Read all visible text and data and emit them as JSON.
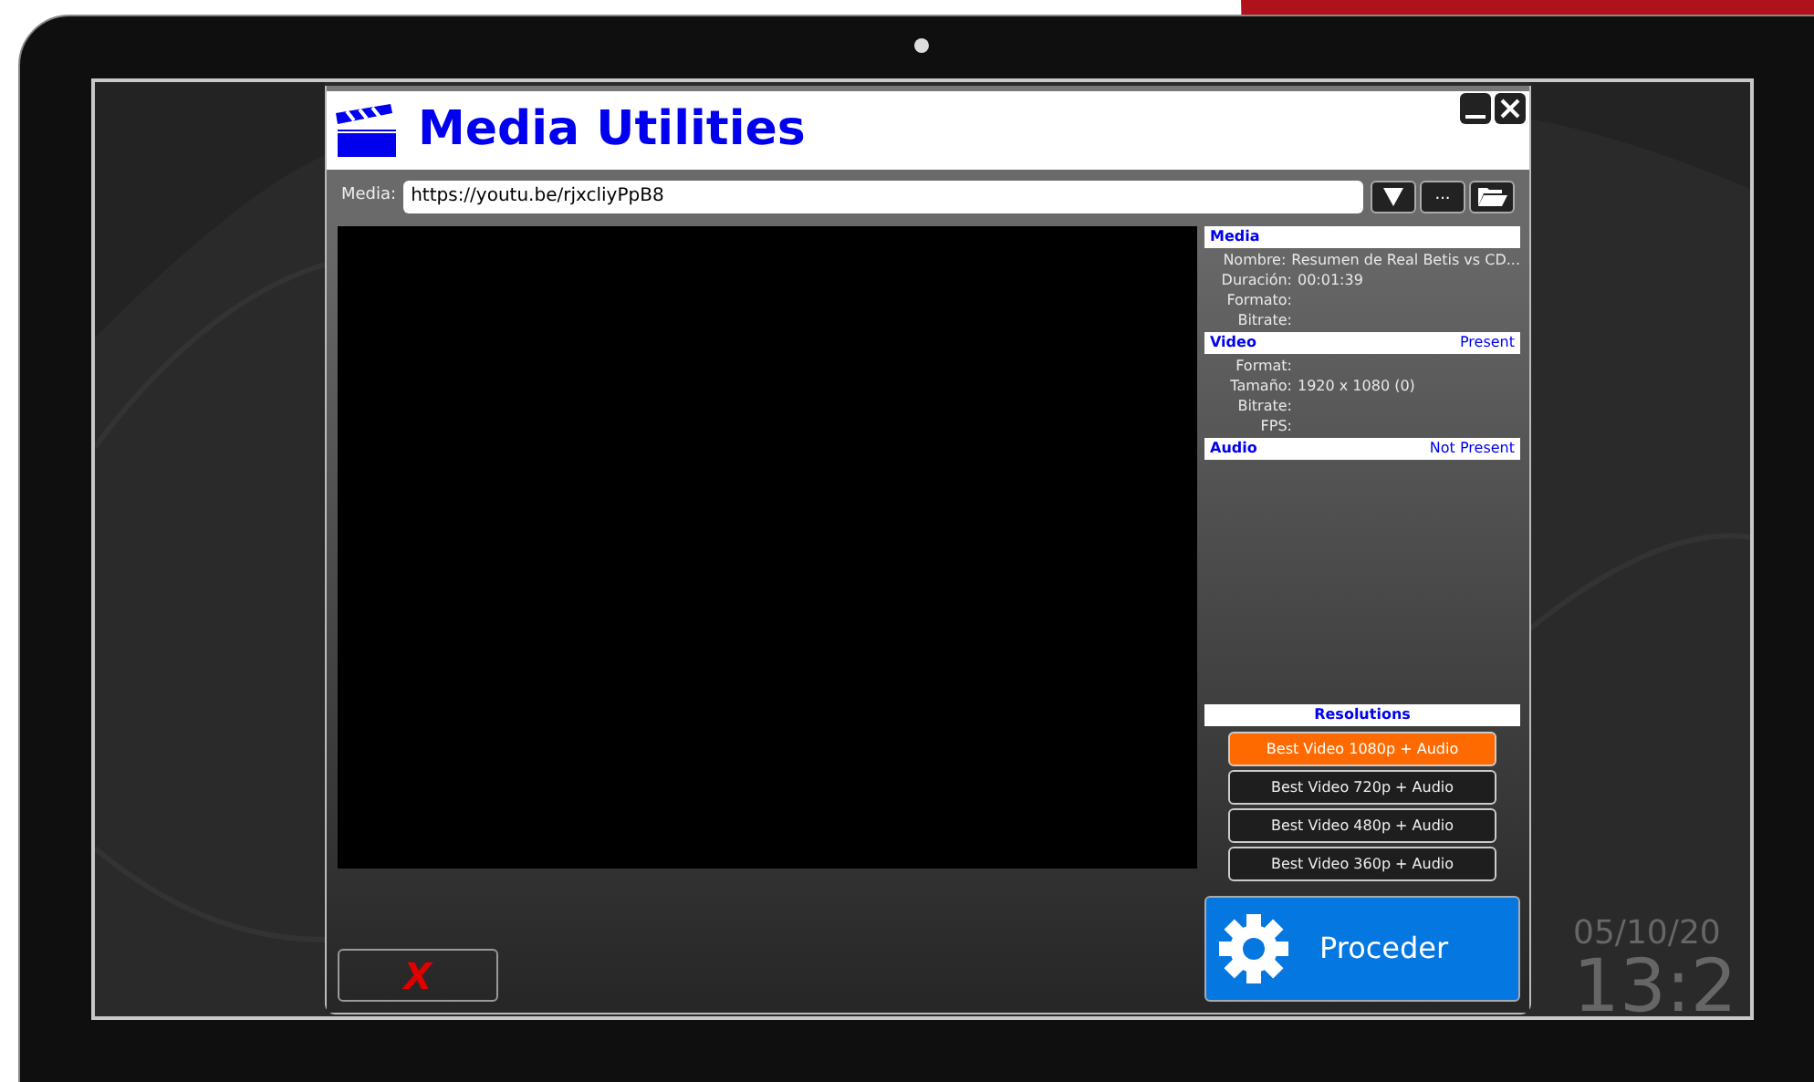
{
  "window": {
    "title": "Media Utilities"
  },
  "media_field": {
    "label": "Media:",
    "value": "https://youtu.be/rjxcliyPpB8"
  },
  "toolbar_buttons": [
    {
      "kind": "dropdown"
    },
    {
      "kind": "text",
      "label": "..."
    },
    {
      "kind": "folder"
    }
  ],
  "info_sections": [
    {
      "title": "Media",
      "rows": [
        {
          "label": "Nombre:",
          "value": "Resumen de Real Betis vs CD..."
        },
        {
          "label": "Duración:",
          "value": "00:01:39"
        },
        {
          "label": "Formato:"
        },
        {
          "label": "Bitrate:"
        }
      ]
    },
    {
      "title": "Video",
      "status": "Present",
      "rows": [
        {
          "label": "Format:"
        },
        {
          "label": "Tamaño:",
          "value": "1920 x 1080 (0)"
        },
        {
          "label": "Bitrate:"
        },
        {
          "label": "FPS:"
        }
      ]
    },
    {
      "title": "Audio",
      "status": "Not Present"
    }
  ],
  "resolutions": {
    "title": "Resolutions",
    "options": [
      {
        "label": "Best Video 1080p + Audio",
        "selected": true
      },
      {
        "label": "Best Video 720p + Audio",
        "selected": false
      },
      {
        "label": "Best Video 480p + Audio",
        "selected": false
      },
      {
        "label": "Best Video 360p + Audio",
        "selected": false
      }
    ]
  },
  "proceed_button": {
    "label": "Proceder"
  },
  "cancel_button": {
    "label": "X"
  },
  "desktop_clock": {
    "date": "05/10/20",
    "time": "13:2"
  }
}
